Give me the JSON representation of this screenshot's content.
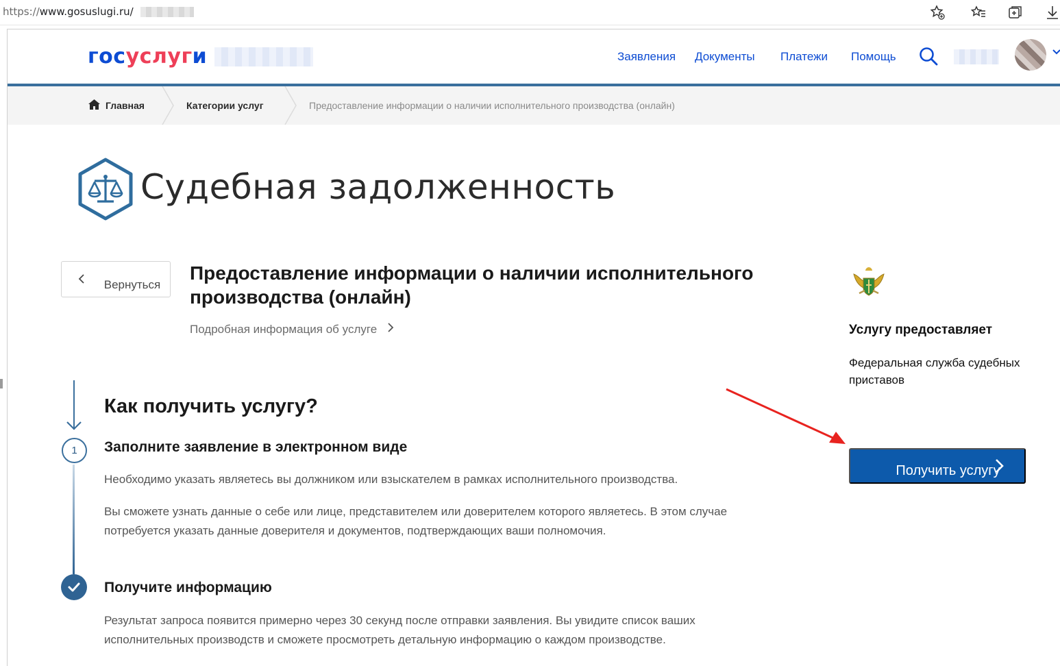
{
  "browser": {
    "url_protocol": "https://",
    "url_host": "www.gosuslugi.ru/"
  },
  "header": {
    "logo": {
      "part1": "гос",
      "part2": "услуг",
      "part3": "и"
    },
    "nav": [
      "Заявления",
      "Документы",
      "Платежи",
      "Помощь"
    ]
  },
  "breadcrumb": {
    "home": "Главная",
    "categories": "Категории услуг",
    "current": "Предоставление информации о наличии исполнительного производства (онлайн)"
  },
  "page": {
    "title": "Судебная задолженность",
    "back_label": "Вернуться",
    "service_title": "Предоставление информации о наличии исполнительного производства (онлайн)",
    "more_info": "Подробная информация об услуге"
  },
  "side": {
    "provides_label": "Услугу предоставляет",
    "provider_name": "Федеральная служба судебных приставов",
    "get_button": "Получить услугу"
  },
  "steps": {
    "heading": "Как получить услугу?",
    "step1": {
      "number": "1",
      "title": "Заполните заявление в электронном виде",
      "p1": "Необходимо указать являетесь вы должником или взыскателем в рамках исполнительного производства.",
      "p2": "Вы сможете узнать данные о себе или лице, представителем или доверителем которого являетесь. В этом случае потребуется указать данные доверителя и документов, подтверждающих ваши полномочия."
    },
    "step2": {
      "title": "Получите информацию",
      "p1": "Результат запроса появится примерно через 30 секунд после отправки заявления. Вы увидите список ваших исполнительных производств и сможете просмотреть детальную информацию о каждом производстве."
    }
  },
  "colors": {
    "brand_blue": "#0d4cd3",
    "brand_red": "#ee3f58",
    "button_blue": "#0d5aab",
    "step_blue": "#2f6393",
    "annotation_red": "#e8231f"
  }
}
